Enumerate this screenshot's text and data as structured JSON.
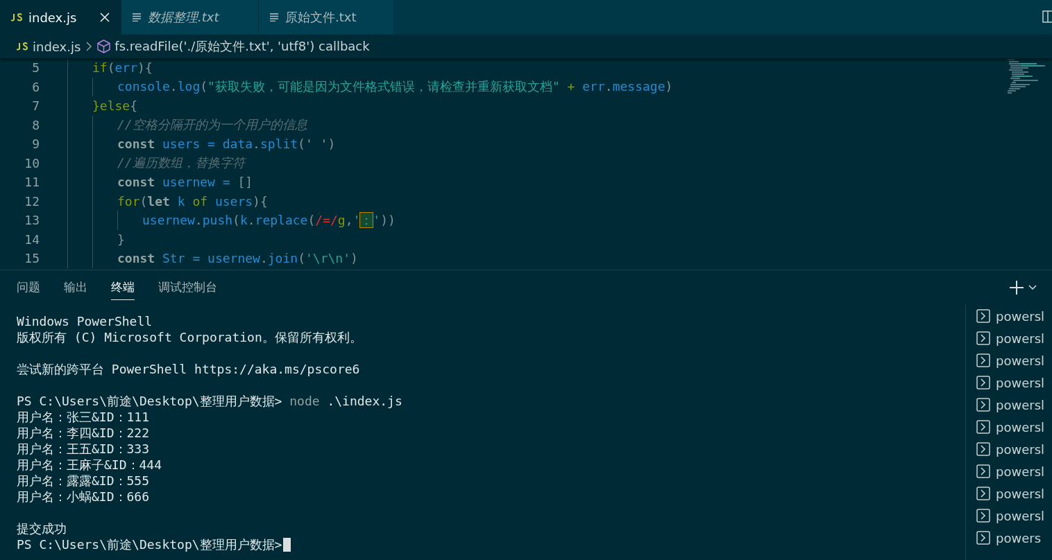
{
  "tabs": [
    {
      "label": "index.js",
      "kind": "js",
      "selected": true,
      "italic": false,
      "closable": true
    },
    {
      "label": "数据整理.txt",
      "kind": "txt",
      "selected": false,
      "italic": true,
      "closable": false
    },
    {
      "label": "原始文件.txt",
      "kind": "txt",
      "selected": false,
      "italic": false,
      "closable": false
    }
  ],
  "breadcrumb": [
    {
      "label": "index.js",
      "kind": "js"
    },
    {
      "label": "fs.readFile('./原始文件.txt', 'utf8') callback",
      "kind": "symbol"
    }
  ],
  "code_lines": [
    {
      "number": "5",
      "tokens": [
        {
          "t": "if",
          "kind": "kw"
        },
        {
          "t": "(",
          "kind": "pun"
        },
        {
          "t": "err",
          "kind": "fn"
        },
        {
          "t": "){",
          "kind": "pun"
        }
      ],
      "children": [
        {
          "number": "6",
          "tokens": [
            {
              "t": "console",
              "kind": "fn"
            },
            {
              "t": ".",
              "kind": "pun"
            },
            {
              "t": "log",
              "kind": "fn"
            },
            {
              "t": "(",
              "kind": "pun"
            },
            {
              "t": "\"获取失败，可能是因为文件格式错误，请检查并重新获取文档\"",
              "kind": "str"
            },
            {
              "t": " + ",
              "kind": "kw"
            },
            {
              "t": "err",
              "kind": "fn"
            },
            {
              "t": ".",
              "kind": "pun"
            },
            {
              "t": "message",
              "kind": "fn"
            },
            {
              "t": ")",
              "kind": "pun"
            }
          ]
        }
      ]
    },
    {
      "number": "7",
      "tokens": [
        {
          "t": "}else",
          "kind": "kw"
        },
        {
          "t": "{",
          "kind": "pun"
        }
      ],
      "children": [
        {
          "number": "8",
          "tokens": [
            {
              "t": "//空格分隔开的为一个用户的信息",
              "kind": "com"
            }
          ]
        },
        {
          "number": "9",
          "tokens": [
            {
              "t": "const ",
              "kind": "decl"
            },
            {
              "t": "users = data",
              "kind": "fn"
            },
            {
              "t": ".",
              "kind": "pun"
            },
            {
              "t": "split",
              "kind": "fn"
            },
            {
              "t": "(' ')",
              "kind": "pun"
            }
          ]
        },
        {
          "number": "10",
          "tokens": [
            {
              "t": "//遍历数组，替换字符",
              "kind": "com"
            }
          ]
        },
        {
          "number": "11",
          "tokens": [
            {
              "t": "const ",
              "kind": "decl"
            },
            {
              "t": "usernew = ",
              "kind": "fn"
            },
            {
              "t": "[]",
              "kind": "pun"
            }
          ]
        },
        {
          "number": "12",
          "tokens": [
            {
              "t": "for",
              "kind": "kw"
            },
            {
              "t": "(",
              "kind": "pun"
            },
            {
              "t": "let ",
              "kind": "decl"
            },
            {
              "t": "k ",
              "kind": "fn"
            },
            {
              "t": "of ",
              "kind": "kw"
            },
            {
              "t": "users",
              "kind": "fn"
            },
            {
              "t": "){",
              "kind": "pun"
            }
          ],
          "children": [
            {
              "number": "13",
              "tokens": [
                {
                  "t": "usernew",
                  "kind": "fn"
                },
                {
                  "t": ".",
                  "kind": "pun"
                },
                {
                  "t": "push",
                  "kind": "fn"
                },
                {
                  "t": "(",
                  "kind": "pun"
                },
                {
                  "t": "k",
                  "kind": "fn"
                },
                {
                  "t": ".",
                  "kind": "pun"
                },
                {
                  "t": "replace",
                  "kind": "fn"
                },
                {
                  "t": "(",
                  "kind": "pun"
                },
                {
                  "t": "/=/",
                  "kind": "re"
                },
                {
                  "t": "g",
                  "kind": "kw"
                },
                {
                  "t": ",",
                  "kind": "pun"
                },
                {
                  "t": "'",
                  "kind": "str"
                },
                {
                  "t": "：",
                  "kind": "hl"
                },
                {
                  "t": "'",
                  "kind": "str"
                },
                {
                  "t": "))",
                  "kind": "pun"
                }
              ]
            }
          ]
        },
        {
          "number": "14",
          "tokens": [
            {
              "t": "}",
              "kind": "pun"
            }
          ]
        },
        {
          "number": "15",
          "tokens": [
            {
              "t": "const ",
              "kind": "decl"
            },
            {
              "t": "Str = usernew",
              "kind": "fn"
            },
            {
              "t": ".",
              "kind": "pun"
            },
            {
              "t": "join",
              "kind": "fn"
            },
            {
              "t": "(",
              "kind": "pun"
            },
            {
              "t": "'\\r\\n'",
              "kind": "str"
            },
            {
              "t": ")",
              "kind": "pun"
            }
          ]
        }
      ]
    }
  ],
  "panel_tabs": [
    {
      "label": "问题",
      "selected": false
    },
    {
      "label": "输出",
      "selected": false
    },
    {
      "label": "终端",
      "selected": true
    },
    {
      "label": "调试控制台",
      "selected": false
    }
  ],
  "terminal_blocks": [
    {
      "lines": [
        {
          "text": "Windows PowerShell"
        },
        {
          "text": "版权所有 (C) Microsoft Corporation。保留所有权利。"
        }
      ]
    },
    {
      "lines": [
        {
          "text": "尝试新的跨平台 PowerShell https://aka.ms/pscore6"
        }
      ]
    },
    {
      "lines": [
        {
          "text": "PS C:\\Users\\前途\\Desktop\\整理用户数据>",
          "command": "node",
          "args": ".\\index.js"
        },
        {
          "text": "用户名：张三&ID：111"
        },
        {
          "text": "用户名：李四&ID：222"
        },
        {
          "text": "用户名：王五&ID：333"
        },
        {
          "text": "用户名：王麻子&ID：444"
        },
        {
          "text": "用户名：露露&ID：555"
        },
        {
          "text": "用户名：小蜗&ID：666"
        }
      ]
    },
    {
      "lines": [
        {
          "text": "提交成功"
        },
        {
          "text": "PS C:\\Users\\前途\\Desktop\\整理用户数据>",
          "cursor": true
        }
      ]
    }
  ],
  "terminal_list": [
    "powersl",
    "powersl",
    "powersl",
    "powersl",
    "powersl",
    "powersl",
    "powersl",
    "powersl",
    "powersl",
    "powersl",
    "powers"
  ]
}
